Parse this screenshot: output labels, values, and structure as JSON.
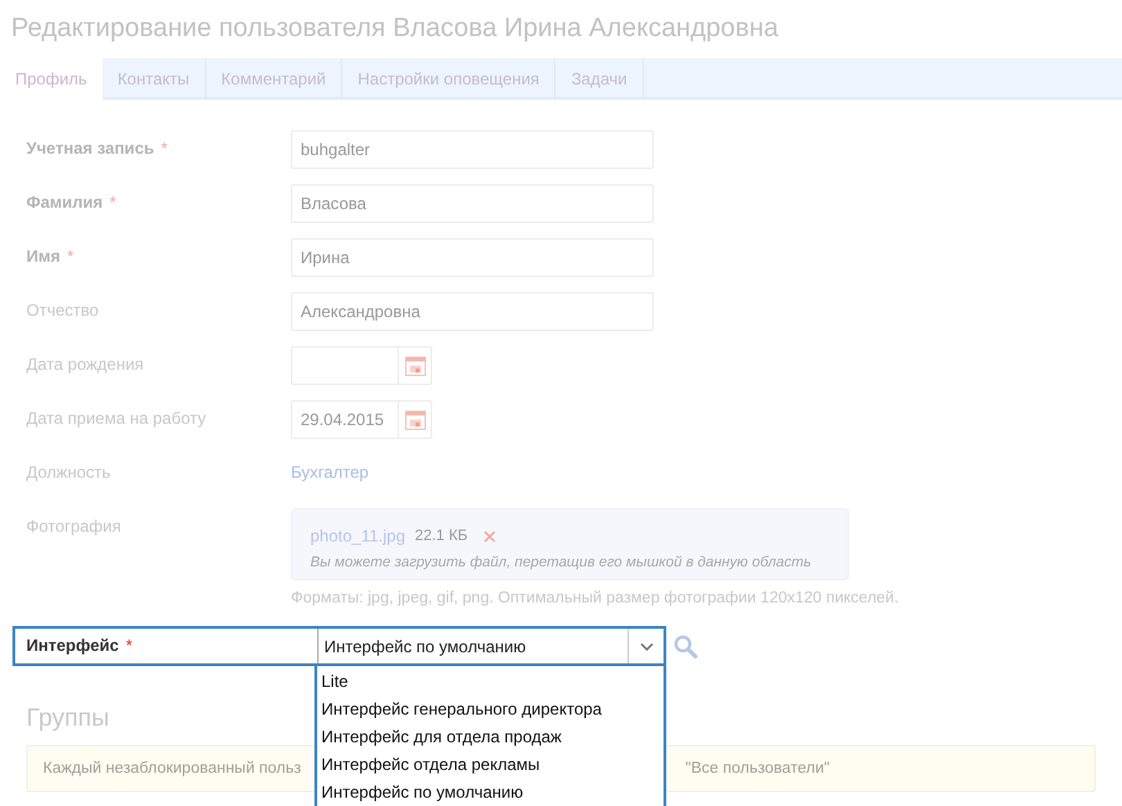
{
  "title": "Редактирование пользователя Власова Ирина Александровна",
  "tabs": [
    {
      "label": "Профиль",
      "selected": true
    },
    {
      "label": "Контакты",
      "selected": false
    },
    {
      "label": "Комментарий",
      "selected": false
    },
    {
      "label": "Настройки оповещения",
      "selected": false
    },
    {
      "label": "Задачи",
      "selected": false
    }
  ],
  "fields": [
    {
      "kind": "text",
      "label": "Учетная запись",
      "mark": "*",
      "value": "buhgalter"
    },
    {
      "kind": "text",
      "label": "Фамилия",
      "mark": "*",
      "value": "Власова"
    },
    {
      "kind": "text",
      "label": "Имя",
      "mark": "*",
      "value": "Ирина"
    },
    {
      "kind": "text",
      "label": "Отчество",
      "value": "Александровна"
    },
    {
      "kind": "date",
      "label": "Дата рождения"
    },
    {
      "kind": "date",
      "label": "Дата приема на работу",
      "value": "29.04.2015"
    },
    {
      "kind": "link",
      "label": "Должность",
      "value": "Бухгалтер"
    },
    {
      "kind": "file",
      "label": "Фотография",
      "file_name": "photo_11.jpg",
      "file_size": "22.1 КБ",
      "drop_hint": "Вы можете загрузить файл, перетащив его мышкой в данную область",
      "note": "Форматы: jpg, jpeg, gif, png. Оптимальный размер фотографии 120x120 пикселей."
    }
  ],
  "interface": {
    "label": "Интерфейс",
    "mark": "*",
    "value": "Интерфейс по умолчанию",
    "expanded": true,
    "options": [
      "Lite",
      "Интерфейс генерального директора",
      "Интерфейс для отдела продаж",
      "Интерфейс отдела рекламы",
      "Интерфейс по умолчанию"
    ]
  },
  "groups": {
    "title": "Группы",
    "notice_left": "Каждый незаблокированный польз",
    "notice_right": "\"Все пользователи\""
  }
}
